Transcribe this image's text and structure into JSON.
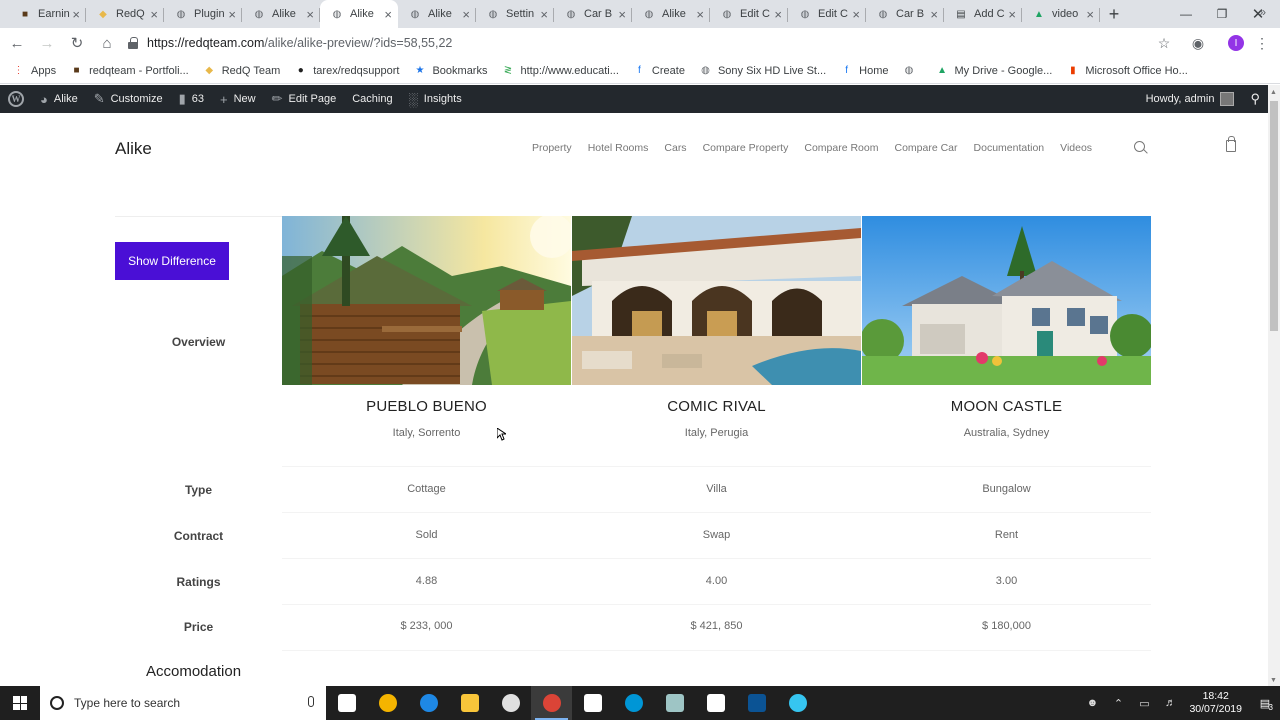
{
  "browser": {
    "tabs": [
      {
        "label": "Earnin",
        "fav_color": "#5a3a1a",
        "fav_glyph": "■",
        "active": false
      },
      {
        "label": "RedQ",
        "fav_color": "#e8b84a",
        "fav_glyph": "◆",
        "active": false
      },
      {
        "label": "Plugin",
        "fav_color": "#5f6368",
        "fav_glyph": "◍",
        "active": false
      },
      {
        "label": "Alike",
        "fav_color": "#5f6368",
        "fav_glyph": "◍",
        "active": false
      },
      {
        "label": "Alike",
        "fav_color": "#5f6368",
        "fav_glyph": "◍",
        "active": true
      },
      {
        "label": "Alike",
        "fav_color": "#5f6368",
        "fav_glyph": "◍",
        "active": false
      },
      {
        "label": "Settin",
        "fav_color": "#5f6368",
        "fav_glyph": "◍",
        "active": false
      },
      {
        "label": "Car B",
        "fav_color": "#5f6368",
        "fav_glyph": "◍",
        "active": false
      },
      {
        "label": "Alike",
        "fav_color": "#5f6368",
        "fav_glyph": "◍",
        "active": false
      },
      {
        "label": "Edit C",
        "fav_color": "#5f6368",
        "fav_glyph": "◍",
        "active": false
      },
      {
        "label": "Edit C",
        "fav_color": "#5f6368",
        "fav_glyph": "◍",
        "active": false
      },
      {
        "label": "Car B",
        "fav_color": "#5f6368",
        "fav_glyph": "◍",
        "active": false
      },
      {
        "label": "Add C",
        "fav_color": "#3c4043",
        "fav_glyph": "▤",
        "active": false
      },
      {
        "label": "video",
        "fav_color": "#1fa463",
        "fav_glyph": "▲",
        "active": false
      }
    ],
    "url_host": "https://redqteam.com",
    "url_path": "/alike/alike-preview/?ids=58,55,22",
    "profile_initial": "I",
    "bookmarks": [
      {
        "label": "Apps",
        "icon": "apps-icon",
        "color": "#ea4335",
        "glyph": "⋮"
      },
      {
        "label": "redqteam - Portfoli...",
        "icon": "portfolio-icon",
        "color": "#5a3a1a",
        "glyph": "■"
      },
      {
        "label": "RedQ Team",
        "icon": "redq-icon",
        "color": "#e8b84a",
        "glyph": "◆"
      },
      {
        "label": "tarex/redqsupport",
        "icon": "github-icon",
        "color": "#222",
        "glyph": "●"
      },
      {
        "label": "Bookmarks",
        "icon": "star-icon",
        "color": "#1a73e8",
        "glyph": "★"
      },
      {
        "label": "http://www.educati...",
        "icon": "education-icon",
        "color": "#34a853",
        "glyph": "≷"
      },
      {
        "label": "Create",
        "icon": "facebook-icon",
        "color": "#1877f2",
        "glyph": "f"
      },
      {
        "label": "Sony Six HD Live St...",
        "icon": "globe-icon",
        "color": "#5f6368",
        "glyph": "◍"
      },
      {
        "label": "Home",
        "icon": "facebook-icon",
        "color": "#1877f2",
        "glyph": "f"
      },
      {
        "label": "",
        "icon": "globe-icon",
        "color": "#5f6368",
        "glyph": "◍"
      },
      {
        "label": "My Drive - Google...",
        "icon": "drive-icon",
        "color": "#1fa463",
        "glyph": "▲"
      },
      {
        "label": "Microsoft Office Ho...",
        "icon": "office-icon",
        "color": "#eb3c00",
        "glyph": "▮"
      }
    ]
  },
  "adminbar": {
    "site": "Alike",
    "customize": "Customize",
    "comments": "63",
    "new": "New",
    "edit": "Edit Page",
    "caching": "Caching",
    "insights": "Insights",
    "howdy": "Howdy, admin"
  },
  "site": {
    "brand": "Alike",
    "nav": [
      "Property",
      "Hotel Rooms",
      "Cars",
      "Compare Property",
      "Compare Room",
      "Compare Car",
      "Documentation",
      "Videos"
    ]
  },
  "compare": {
    "show_difference": "Show Difference",
    "labels": {
      "overview": "Overview",
      "type": "Type",
      "contract": "Contract",
      "ratings": "Ratings",
      "price": "Price"
    },
    "section": "Accomodation",
    "properties": [
      {
        "name": "PUEBLO BUENO",
        "location": "Italy, Sorrento",
        "type": "Cottage",
        "contract": "Sold",
        "rating": "4.88",
        "price": "$ 233, 000"
      },
      {
        "name": "COMIC RIVAL",
        "location": "Italy, Perugia",
        "type": "Villa",
        "contract": "Swap",
        "rating": "4.00",
        "price": "$ 421, 850"
      },
      {
        "name": "MOON CASTLE",
        "location": "Australia, Sydney",
        "type": "Bungalow",
        "contract": "Rent",
        "rating": "3.00",
        "price": "$ 180,000"
      }
    ]
  },
  "taskbar": {
    "search_placeholder": "Type here to search",
    "time": "18:42",
    "date": "30/07/2019",
    "notifications": "3",
    "apps": [
      {
        "name": "task-view-icon",
        "color": "#ffffff"
      },
      {
        "name": "chrome-dev-icon",
        "color": "#f4b400"
      },
      {
        "name": "edge-icon",
        "color": "#1e88e5"
      },
      {
        "name": "file-explorer-icon",
        "color": "#f8c53a"
      },
      {
        "name": "camera-app-icon",
        "color": "#e0e0e0"
      },
      {
        "name": "chrome-icon",
        "color": "#db4437"
      },
      {
        "name": "store-icon",
        "color": "#ffffff"
      },
      {
        "name": "hp-icon",
        "color": "#0096d6"
      },
      {
        "name": "photos-icon",
        "color": "#9ec5c5"
      },
      {
        "name": "mail-icon",
        "color": "#ffffff"
      },
      {
        "name": "app-icon",
        "color": "#0b5394"
      },
      {
        "name": "slack-icon",
        "color": "#36c5f0"
      }
    ]
  }
}
